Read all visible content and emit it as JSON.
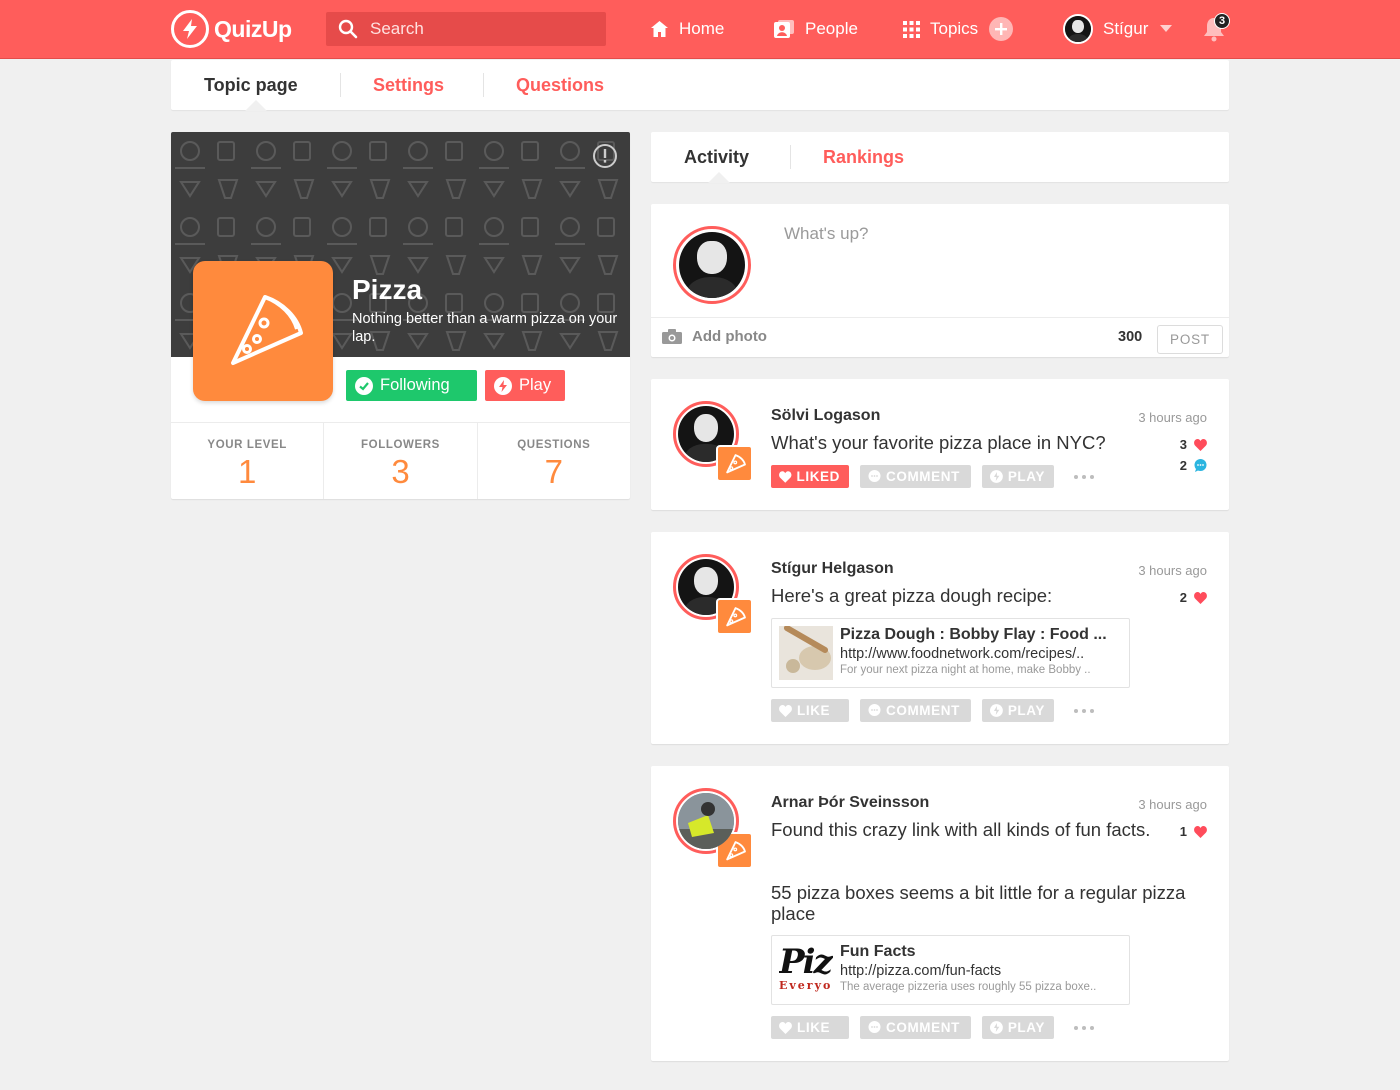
{
  "header": {
    "brand": "QuizUp",
    "search_placeholder": "Search",
    "nav": {
      "home": "Home",
      "people": "People",
      "topics": "Topics",
      "user": "Stígur"
    },
    "notification_count": "3",
    "accent_color": "#ff5d5b"
  },
  "page_tabs": [
    {
      "label": "Topic page",
      "active": true
    },
    {
      "label": "Settings",
      "active": false
    },
    {
      "label": "Questions",
      "active": false
    }
  ],
  "topic": {
    "name": "Pizza",
    "description": "Nothing better than a warm pizza on your lap.",
    "icon": "pizza-slice-icon",
    "icon_color": "#ff8a3d",
    "following_label": "Following",
    "play_label": "Play",
    "stats": [
      {
        "label": "YOUR LEVEL",
        "value": "1"
      },
      {
        "label": "FOLLOWERS",
        "value": "3"
      },
      {
        "label": "QUESTIONS",
        "value": "7"
      }
    ]
  },
  "feed_tabs": [
    {
      "label": "Activity",
      "active": true
    },
    {
      "label": "Rankings",
      "active": false
    }
  ],
  "composer": {
    "placeholder": "What's up?",
    "add_photo": "Add photo",
    "char_count": "300",
    "post_label": "POST"
  },
  "actions": {
    "liked": "LIKED",
    "like": "LIKE",
    "comment": "COMMENT",
    "play": "PLAY"
  },
  "posts": [
    {
      "author": "Sölvi Logason",
      "time": "3 hours ago",
      "text": "What's your favorite pizza place in NYC?",
      "likes": "3",
      "comments": "2",
      "liked": true
    },
    {
      "author": "Stígur Helgason",
      "time": "3 hours ago",
      "text": "Here's a great pizza dough recipe:",
      "likes": "2",
      "liked": false,
      "link": {
        "title": "Pizza Dough : Bobby Flay : Food ...",
        "url": "http://www.foodnetwork.com/recipes/..",
        "description": "For your next pizza night at home, make Bobby .."
      }
    },
    {
      "author": "Arnar Þór Sveinsson",
      "time": "3 hours ago",
      "text": "Found this crazy link with all kinds of fun facts.",
      "text2": "55 pizza boxes seems a bit little for a regular pizza place",
      "likes": "1",
      "liked": false,
      "link": {
        "title": "Fun Facts",
        "url": "http://pizza.com/fun-facts",
        "description": "The average pizzeria uses roughly 55 pizza boxe..",
        "thumb_text": "Piz",
        "thumb_subtext": "Everyo"
      }
    }
  ]
}
